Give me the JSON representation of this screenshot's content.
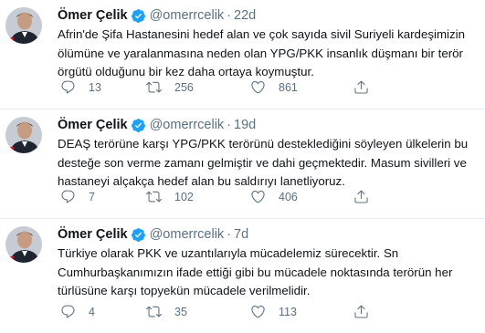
{
  "author": {
    "name": "Ömer Çelik",
    "handle": "@omerrcelik"
  },
  "tweets": [
    {
      "time": "22d",
      "lines": [
        "Afrin'de Şifa Hastanesini hedef alan ve çok sayıda sivil Suriyeli kardeşimizin",
        "ölümüne ve yaralanmasına neden olan YPG/PKK insanlık düşmanı bir terör",
        "örgütü olduğunu bir kez daha ortaya koymuştur."
      ],
      "replies": "13",
      "retweets": "256",
      "likes": "861"
    },
    {
      "time": "19d",
      "lines": [
        "DEAŞ terörüne karşı YPG/PKK terörünü desteklediğini söyleyen ülkelerin bu",
        "desteğe son verme zamanı gelmiştir ve dahi geçmektedir. Masum sivilleri ve",
        "hastaneyi alçakça hedef alan bu saldırıyı lanetliyoruz."
      ],
      "replies": "7",
      "retweets": "102",
      "likes": "406"
    },
    {
      "time": "7d",
      "lines": [
        "Türkiye olarak PKK ve uzantılarıyla mücadelemiz sürecektir. Sn",
        "Cumhurbaşkanımızın ifade ettiği gibi bu mücadele noktasında terörün her",
        "türlüsüne karşı topyekün mücadele verilmelidir."
      ],
      "replies": "4",
      "retweets": "35",
      "likes": "113"
    }
  ],
  "icons": {
    "reply": "reply-icon",
    "retweet": "retweet-icon",
    "like": "heart-icon",
    "share": "share-icon",
    "verified": "verified-badge-icon"
  },
  "colors": {
    "text": "#0f1419",
    "muted": "#5b7083",
    "verified": "#1da1f2",
    "divider": "#e6ecf0"
  }
}
